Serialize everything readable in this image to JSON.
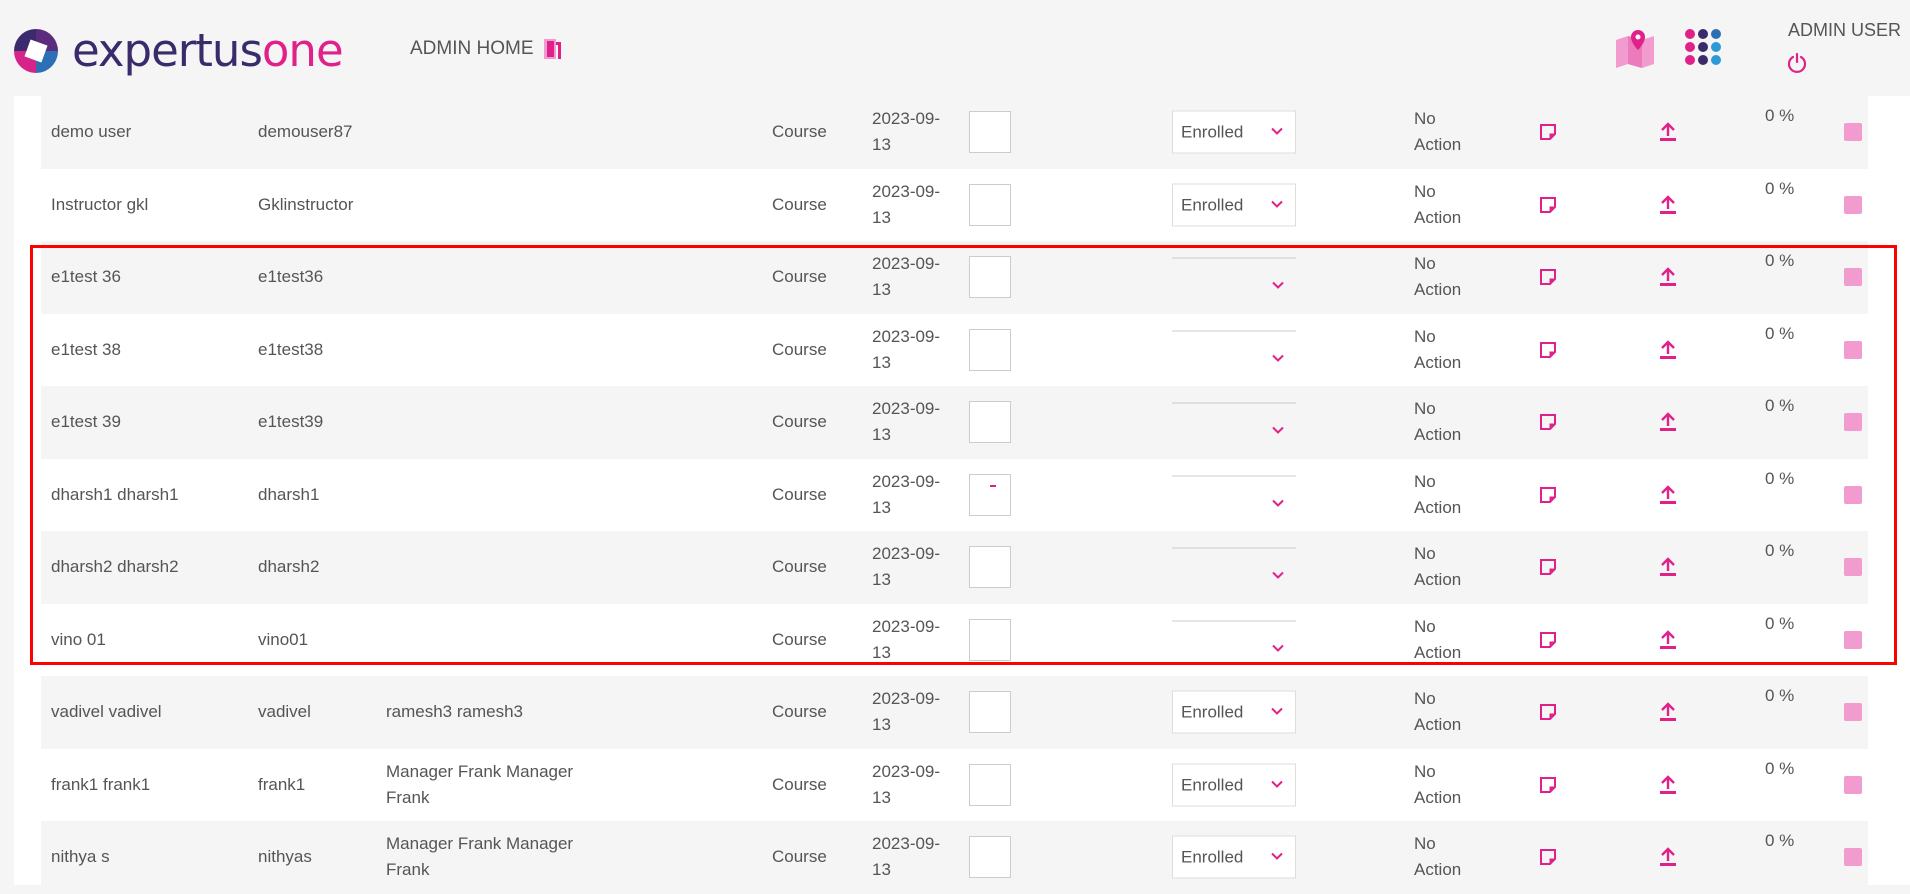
{
  "header": {
    "logo_part1": "expertus",
    "logo_part2": "one",
    "admin_home": "ADMIN HOME",
    "admin_user": "ADMIN USER"
  },
  "colors": {
    "accent": "#e0218a",
    "brand_dark": "#3a2b6b",
    "highlight": "#ff0000",
    "row_shade": "#f5f5f5"
  },
  "icons": [
    "door-icon",
    "map-icon",
    "apps-grid-icon",
    "power-icon",
    "note-icon",
    "upload-icon",
    "chevron-down-icon"
  ],
  "rows": [
    {
      "name": "demo user",
      "username": "demouser87",
      "manager": "",
      "type": "Course",
      "date": "2023-09-13",
      "status": "Enrolled",
      "action": "No Action",
      "progress": "0 %",
      "box_mark": false
    },
    {
      "name": "Instructor gkl",
      "username": "Gklinstructor",
      "manager": "",
      "type": "Course",
      "date": "2023-09-13",
      "status": "Enrolled",
      "action": "No Action",
      "progress": "0 %",
      "box_mark": false
    },
    {
      "name": "e1test 36",
      "username": "e1test36",
      "manager": "",
      "type": "Course",
      "date": "2023-09-13",
      "status": "",
      "action": "No Action",
      "progress": "0 %",
      "box_mark": false
    },
    {
      "name": "e1test 38",
      "username": "e1test38",
      "manager": "",
      "type": "Course",
      "date": "2023-09-13",
      "status": "",
      "action": "No Action",
      "progress": "0 %",
      "box_mark": false
    },
    {
      "name": "e1test 39",
      "username": "e1test39",
      "manager": "",
      "type": "Course",
      "date": "2023-09-13",
      "status": "",
      "action": "No Action",
      "progress": "0 %",
      "box_mark": false
    },
    {
      "name": "dharsh1 dharsh1",
      "username": "dharsh1",
      "manager": "",
      "type": "Course",
      "date": "2023-09-13",
      "status": "",
      "action": "No Action",
      "progress": "0 %",
      "box_mark": true
    },
    {
      "name": "dharsh2 dharsh2",
      "username": "dharsh2",
      "manager": "",
      "type": "Course",
      "date": "2023-09-13",
      "status": "",
      "action": "No Action",
      "progress": "0 %",
      "box_mark": false
    },
    {
      "name": "vino 01",
      "username": "vino01",
      "manager": "",
      "type": "Course",
      "date": "2023-09-13",
      "status": "",
      "action": "No Action",
      "progress": "0 %",
      "box_mark": false
    },
    {
      "name": "vadivel vadivel",
      "username": "vadivel",
      "manager": "ramesh3 ramesh3",
      "type": "Course",
      "date": "2023-09-13",
      "status": "Enrolled",
      "action": "No Action",
      "progress": "0 %",
      "box_mark": false
    },
    {
      "name": "frank1 frank1",
      "username": "frank1",
      "manager": "Manager Frank Manager Frank",
      "type": "Course",
      "date": "2023-09-13",
      "status": "Enrolled",
      "action": "No Action",
      "progress": "0 %",
      "box_mark": false
    },
    {
      "name": "nithya s",
      "username": "nithyas",
      "manager": "Manager Frank Manager Frank",
      "type": "Course",
      "date": "2023-09-13",
      "status": "Enrolled",
      "action": "No Action",
      "progress": "0 %",
      "box_mark": false
    }
  ]
}
